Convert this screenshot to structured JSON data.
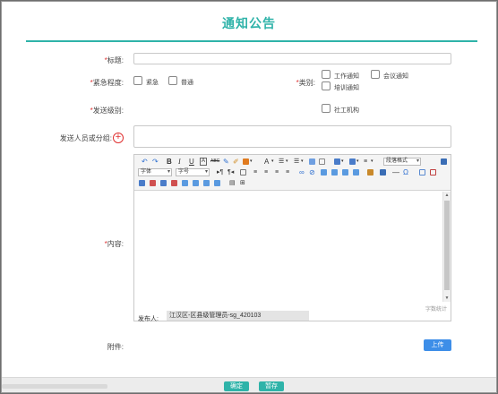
{
  "page": {
    "title": "通知公告"
  },
  "form": {
    "title_label": "标题:",
    "urgency_label": "紧急程度:",
    "urgency_options": [
      "紧急",
      "普通"
    ],
    "category_label": "类别:",
    "category_options": [
      "工作通知",
      "会议通知",
      "培训通知"
    ],
    "send_level_label": "发送级别:",
    "send_level_option": "社工机构",
    "recipients_label": "发送人员或分组:",
    "content_label": "内容:",
    "attachment_label": "附件:",
    "upload_label": "上传"
  },
  "editor": {
    "format_select": "段落格式",
    "font_family_select": "字体",
    "font_size_select": "字号",
    "word_count_label": "字数统计",
    "author_label": "发布人:",
    "author_value": "江汉区-区县级管理员-sg_420103"
  },
  "footer": {
    "confirm_label": "确定",
    "save_draft_label": "暂存"
  },
  "colors": {
    "accent": "#2fb3a9",
    "upload": "#3d8ee8",
    "required": "#d33333"
  }
}
